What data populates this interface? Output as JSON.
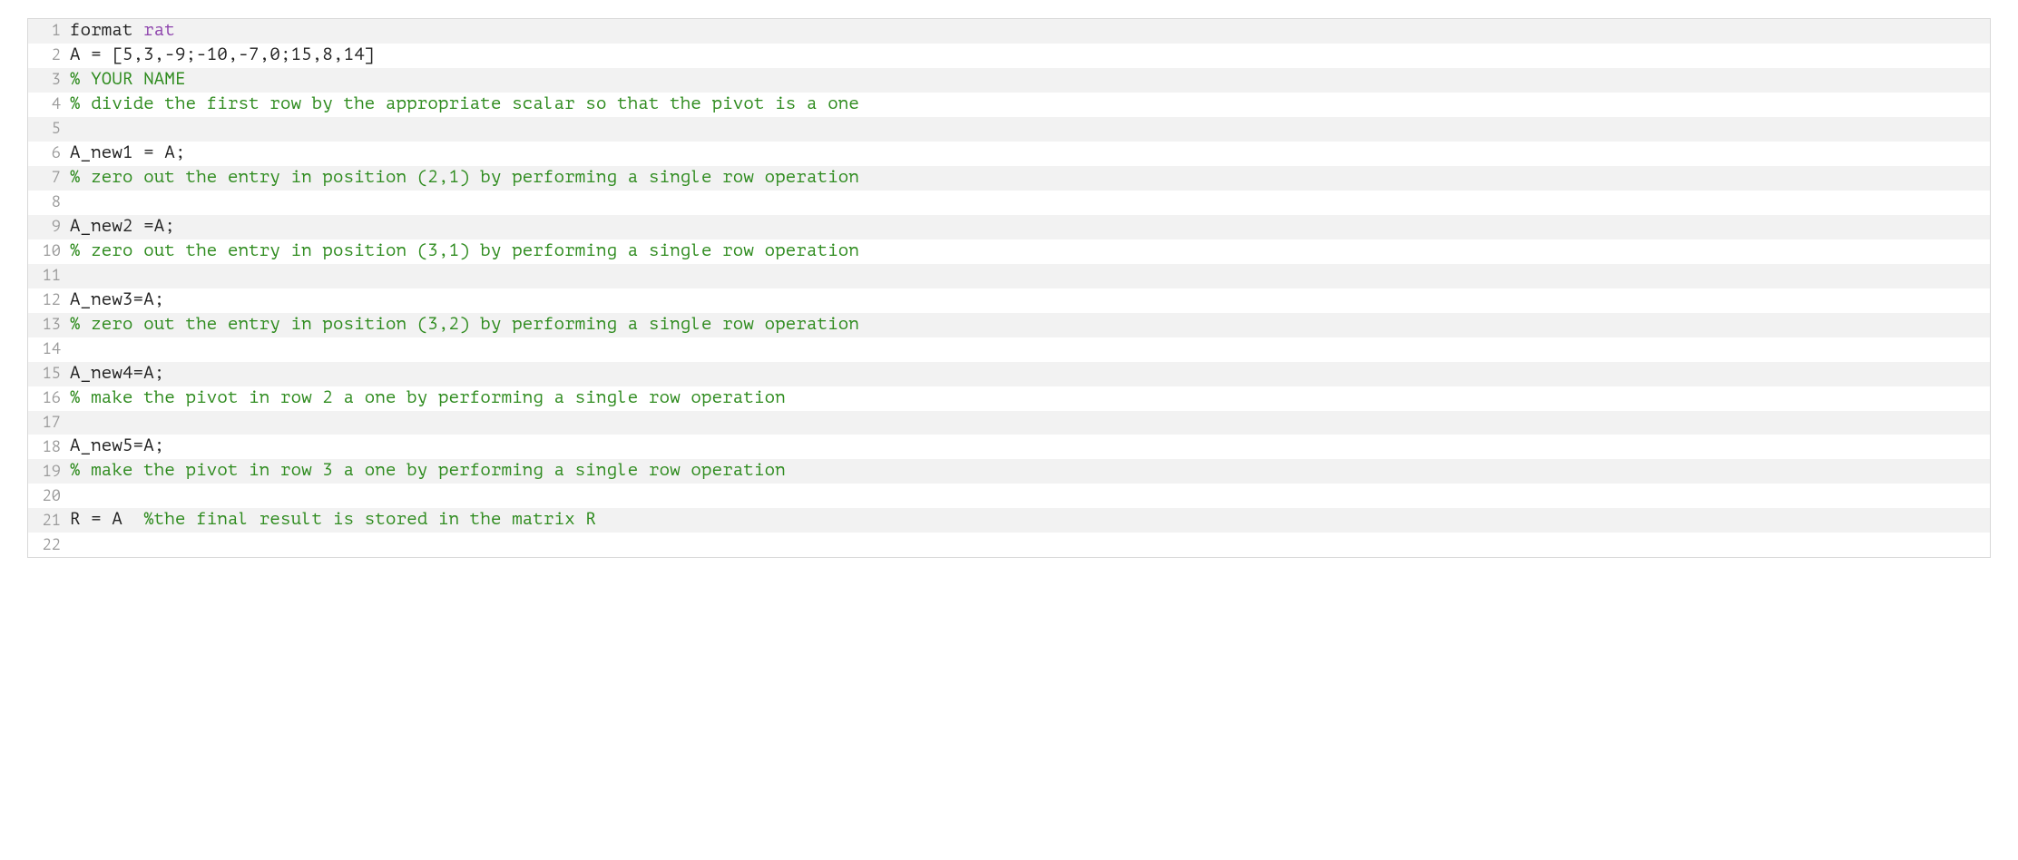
{
  "code": {
    "lines": [
      {
        "num": "1",
        "tokens": [
          {
            "t": "format ",
            "c": "default"
          },
          {
            "t": "rat",
            "c": "keyword"
          }
        ]
      },
      {
        "num": "2",
        "tokens": [
          {
            "t": "A = [5,3,-9;-10,-7,0;15,8,14]",
            "c": "default"
          }
        ]
      },
      {
        "num": "3",
        "tokens": [
          {
            "t": "% YOUR NAME",
            "c": "comment"
          }
        ]
      },
      {
        "num": "4",
        "tokens": [
          {
            "t": "% divide the first row by the appropriate scalar so that the pivot is a one",
            "c": "comment"
          }
        ]
      },
      {
        "num": "5",
        "tokens": [
          {
            "t": "",
            "c": "default"
          }
        ]
      },
      {
        "num": "6",
        "tokens": [
          {
            "t": "A_new1 = A;",
            "c": "default"
          }
        ]
      },
      {
        "num": "7",
        "tokens": [
          {
            "t": "% zero out the entry in position (2,1) by performing a single row operation",
            "c": "comment"
          }
        ]
      },
      {
        "num": "8",
        "tokens": [
          {
            "t": "",
            "c": "default"
          }
        ]
      },
      {
        "num": "9",
        "tokens": [
          {
            "t": "A_new2 =A;",
            "c": "default"
          }
        ]
      },
      {
        "num": "10",
        "tokens": [
          {
            "t": "% zero out the entry in position (3,1) by performing a single row operation",
            "c": "comment"
          }
        ]
      },
      {
        "num": "11",
        "tokens": [
          {
            "t": "",
            "c": "default"
          }
        ]
      },
      {
        "num": "12",
        "tokens": [
          {
            "t": "A_new3=A;",
            "c": "default"
          }
        ]
      },
      {
        "num": "13",
        "tokens": [
          {
            "t": "% zero out the entry in position (3,2) by performing a single row operation",
            "c": "comment"
          }
        ]
      },
      {
        "num": "14",
        "tokens": [
          {
            "t": "",
            "c": "default"
          }
        ]
      },
      {
        "num": "15",
        "tokens": [
          {
            "t": "A_new4=A;",
            "c": "default"
          }
        ]
      },
      {
        "num": "16",
        "tokens": [
          {
            "t": "% make the pivot in row 2 a one by performing a single row operation",
            "c": "comment"
          }
        ]
      },
      {
        "num": "17",
        "tokens": [
          {
            "t": "",
            "c": "default"
          }
        ]
      },
      {
        "num": "18",
        "tokens": [
          {
            "t": "A_new5=A;",
            "c": "default"
          }
        ]
      },
      {
        "num": "19",
        "tokens": [
          {
            "t": "% make the pivot in row 3 a one by performing a single row operation",
            "c": "comment"
          }
        ]
      },
      {
        "num": "20",
        "tokens": [
          {
            "t": "",
            "c": "default"
          }
        ]
      },
      {
        "num": "21",
        "tokens": [
          {
            "t": "R = A  ",
            "c": "default"
          },
          {
            "t": "%the final result is stored in the matrix R",
            "c": "comment"
          }
        ]
      },
      {
        "num": "22",
        "tokens": [
          {
            "t": "",
            "c": "default"
          }
        ]
      }
    ]
  }
}
